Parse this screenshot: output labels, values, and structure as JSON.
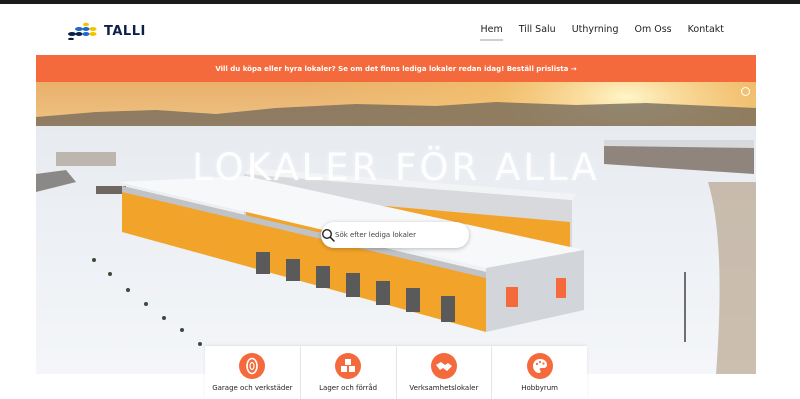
{
  "brand": {
    "name": "TALLI",
    "accent": "#f46a3c",
    "navy": "#0d2148",
    "logo_blue": "#1f69c9",
    "logo_yellow": "#f5c400"
  },
  "nav": {
    "items": [
      {
        "label": "Hem",
        "active": true
      },
      {
        "label": "Till Salu",
        "active": false
      },
      {
        "label": "Uthyrning",
        "active": false
      },
      {
        "label": "Om Oss",
        "active": false
      },
      {
        "label": "Kontakt",
        "active": false
      }
    ]
  },
  "banner": {
    "text": "Vill du köpa eller hyra lokaler? Se om det finns lediga lokaler redan idag! Beställ prislista →"
  },
  "hero": {
    "title": "LOKALER FÖR ALLA",
    "search": {
      "placeholder": "Sök efter lediga lokaler",
      "icon": "search-icon"
    }
  },
  "categories": [
    {
      "label": "Garage och verkstäder",
      "icon": "tire-icon"
    },
    {
      "label": "Lager och förråd",
      "icon": "boxes-icon"
    },
    {
      "label": "Verksamhetslokaler",
      "icon": "handshake-icon"
    },
    {
      "label": "Hobbyrum",
      "icon": "palette-icon"
    }
  ]
}
